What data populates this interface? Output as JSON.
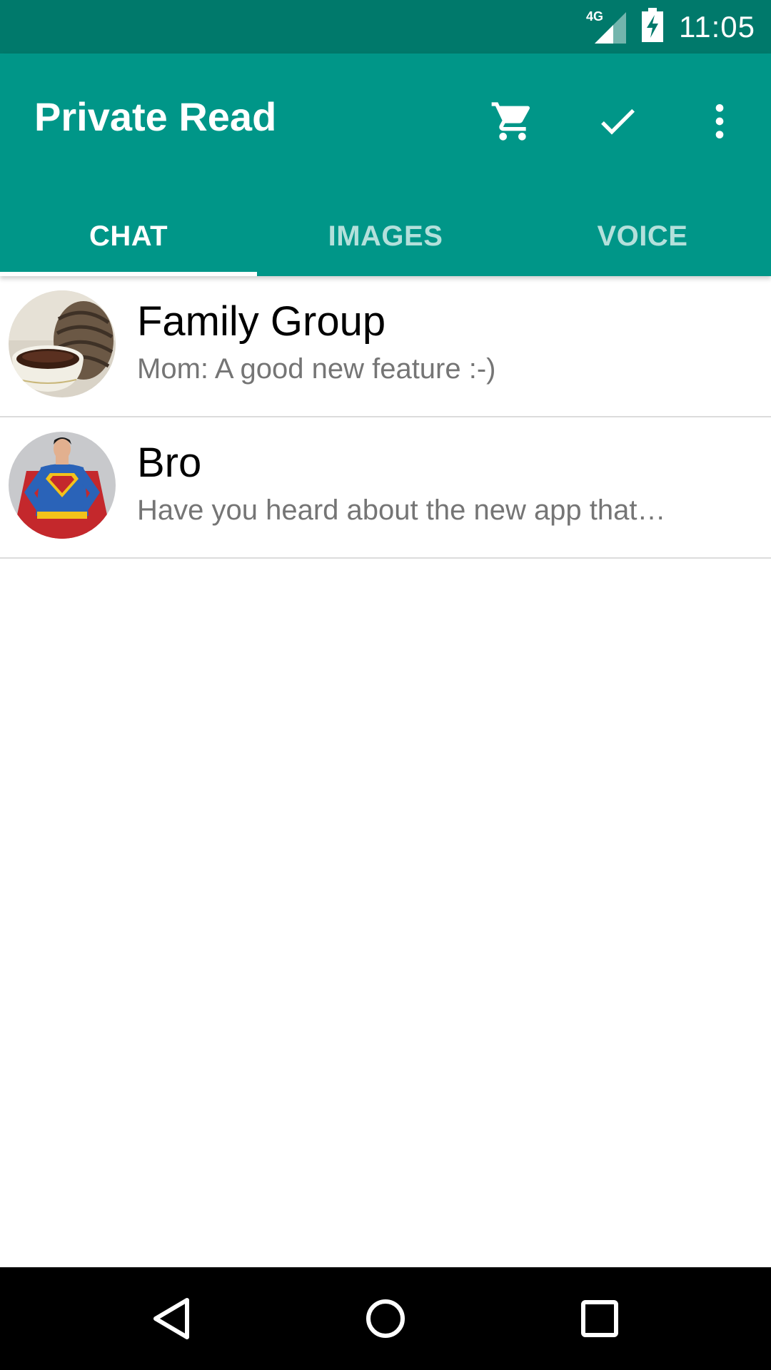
{
  "status_bar": {
    "network": "4G",
    "time": "11:05"
  },
  "app_bar": {
    "title": "Private Read",
    "actions": [
      {
        "icon": "cart-icon"
      },
      {
        "icon": "check-icon"
      },
      {
        "icon": "more-vert-icon"
      }
    ]
  },
  "tabs": [
    {
      "label": "CHAT",
      "active": true
    },
    {
      "label": "IMAGES",
      "active": false
    },
    {
      "label": "VOICE",
      "active": false
    }
  ],
  "chats": [
    {
      "name": "Family Group",
      "preview": "Mom: A good new feature :-)",
      "avatar": "coffee-pinecone-avatar"
    },
    {
      "name": "Bro",
      "preview": "Have you heard about the new app that…",
      "avatar": "superhero-avatar"
    }
  ],
  "nav_bar": {
    "buttons": [
      "back-icon",
      "home-icon",
      "recents-icon"
    ]
  },
  "colors": {
    "status_bar": "#00796b",
    "primary": "#009688",
    "divider": "#dcdcdc",
    "secondary_text": "#757575"
  }
}
